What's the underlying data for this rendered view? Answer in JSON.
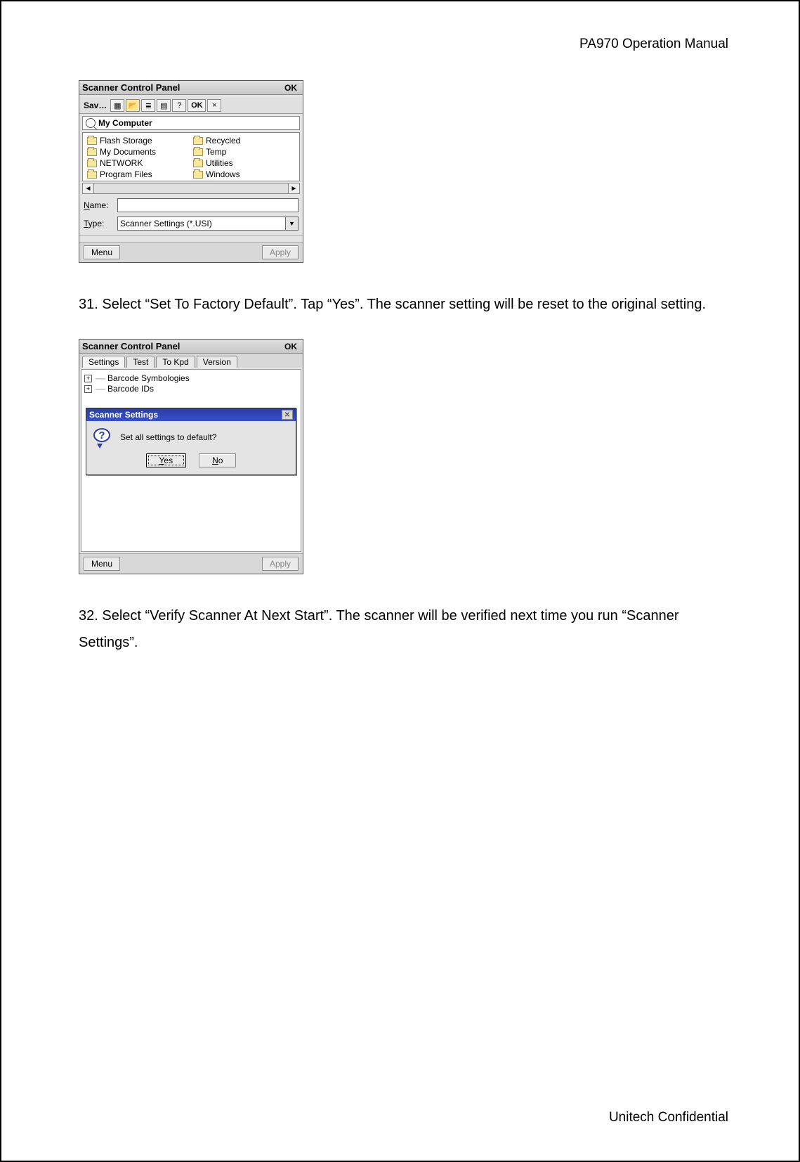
{
  "header": {
    "title": "PA970 Operation Manual"
  },
  "footer": {
    "text": "Unitech Confidential"
  },
  "para1": "31. Select “Set To Factory Default”. Tap “Yes”. The scanner setting will be reset to the original setting.",
  "para2": "32. Select “Verify Scanner At Next Start”. The scanner will be verified next time you run “Scanner Settings”.",
  "shot1": {
    "title": "Scanner Control Panel",
    "ok": "OK",
    "save_label": "Sav…",
    "toolbar_ok": "OK",
    "toolbar_help": "?",
    "toolbar_close": "×",
    "location_label": "My Computer",
    "folders_left": [
      "Flash Storage",
      "My Documents",
      "NETWORK",
      "Program Files"
    ],
    "folders_right": [
      "Recycled",
      "Temp",
      "Utilities",
      "Windows"
    ],
    "name_label": "Name:",
    "name_value": "",
    "type_label": "Type:",
    "type_value": "Scanner Settings (*.USI)",
    "menu_btn": "Menu",
    "apply_btn": "Apply"
  },
  "shot2": {
    "title": "Scanner Control Panel",
    "ok": "OK",
    "tabs": [
      "Settings",
      "Test",
      "To Kpd",
      "Version"
    ],
    "tree_items": [
      "Barcode Symbologies",
      "Barcode IDs"
    ],
    "modal_title": "Scanner Settings",
    "modal_msg": "Set all settings to default?",
    "yes": "Yes",
    "no": "No",
    "menu_btn": "Menu",
    "apply_btn": "Apply"
  }
}
